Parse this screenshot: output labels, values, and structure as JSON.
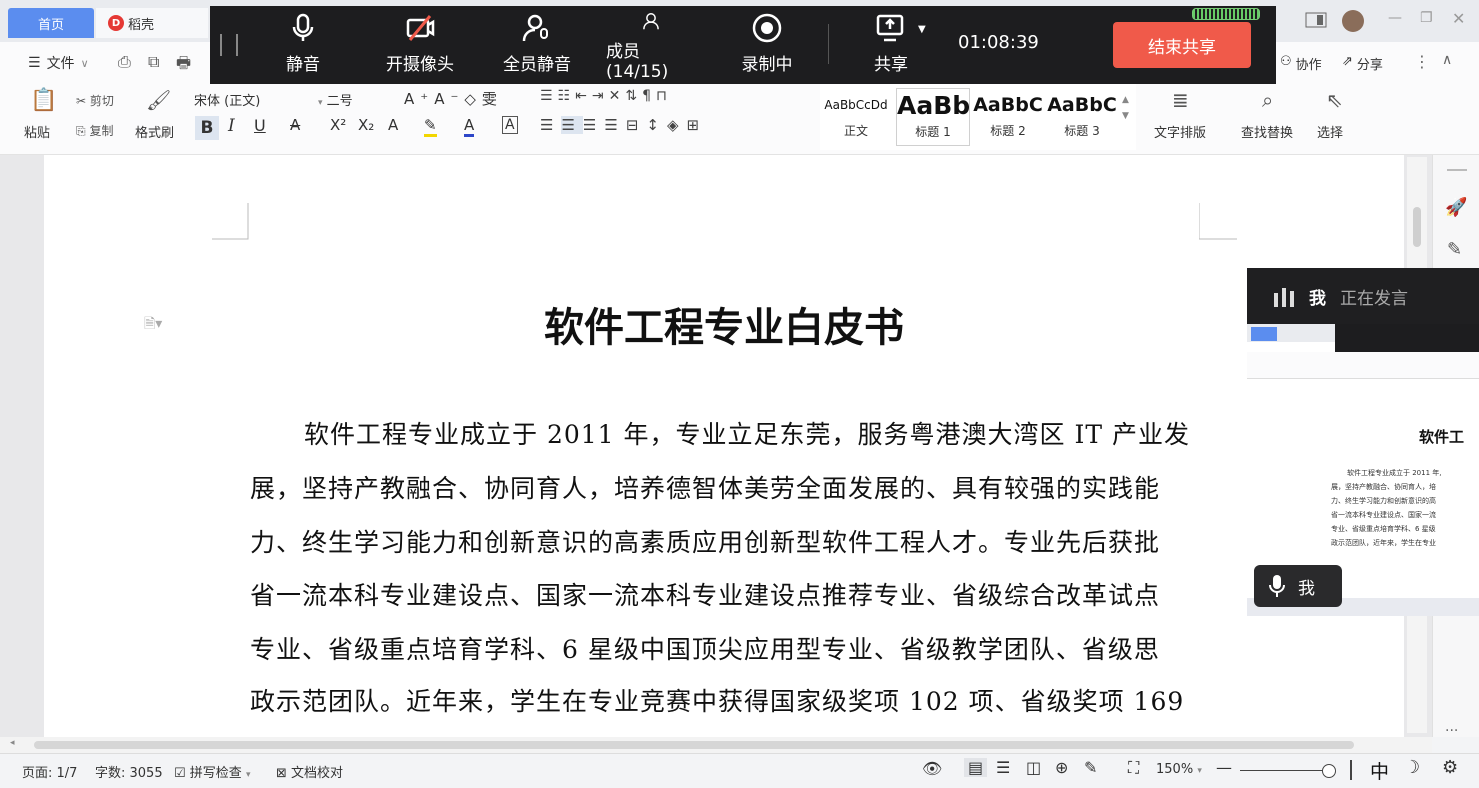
{
  "tabs": {
    "home": "首页",
    "docke": "稻壳"
  },
  "meeting": {
    "mute": "静音",
    "camera": "开摄像头",
    "mute_all": "全员静音",
    "members": "成员(14/15)",
    "recording": "录制中",
    "share": "共享",
    "timer": "01:08:39",
    "end_share": "结束共享"
  },
  "menu": {
    "file": "文件",
    "collab": "协作",
    "share": "分享"
  },
  "ribbon": {
    "paste": "粘贴",
    "cut": "剪切",
    "copy": "复制",
    "format_painter": "格式刷",
    "font_name": "宋体 (正文)",
    "font_size": "二号",
    "styles": [
      {
        "preview": "AaBbCcDd",
        "label": "正文"
      },
      {
        "preview": "AaBb",
        "label": "标题 1"
      },
      {
        "preview": "AaBbC",
        "label": "标题 2"
      },
      {
        "preview": "AaBbC",
        "label": "标题 3"
      }
    ],
    "text_layout": "文字排版",
    "find_replace": "查找替换",
    "select": "选择"
  },
  "document": {
    "title": "软件工程专业白皮书",
    "lines": [
      "软件工程专业成立于 2011 年，专业立足东莞，服务粤港澳大湾区 IT 产业发",
      "展，坚持产教融合、协同育人，培养德智体美劳全面发展的、具有较强的实践能",
      "力、终生学习能力和创新意识的高素质应用创新型软件工程人才。专业先后获批",
      "省一流本科专业建设点、国家一流本科专业建设点推荐专业、省级综合改革试点",
      "专业、省级重点培育学科、6 星级中国顶尖应用型专业、省级教学团队、省级思",
      "政示范团队。近年来，学生在专业竞赛中获得国家级奖项 102 项、省级奖项 169"
    ]
  },
  "video": {
    "me": "我",
    "speaking": "正在发言",
    "mic_label": "我",
    "thumb_title": "软件工",
    "thumb_lines": [
      "软件工程专业成立于 2011 年,",
      "展，坚持产教融合、协同育人，培",
      "力、终生学习能力和创新意识的高",
      "省一流本科专业建设点、国家一流",
      "专业、省级重点培育学科、6 星级",
      "政示范团队，近年来，学生在专业"
    ]
  },
  "status": {
    "page": "页面: 1/7",
    "words": "字数: 3055",
    "spellcheck": "拼写检查",
    "proofread": "文档校对",
    "zoom": "150%",
    "ime": "中"
  }
}
